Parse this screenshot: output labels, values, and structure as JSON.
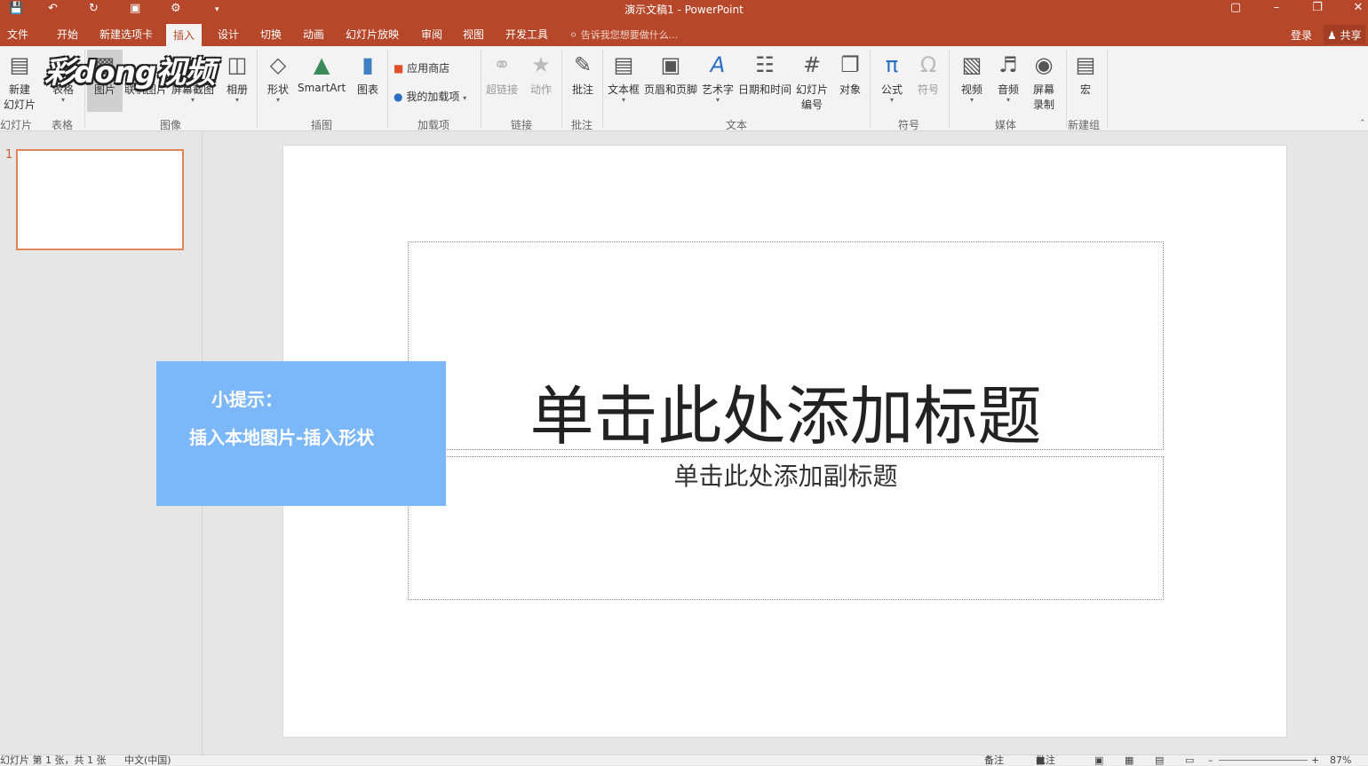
{
  "titlebar": {
    "title": "演示文稿1 - PowerPoint",
    "qa_save_icon": "save-icon",
    "qa_undo_icon": "undo-icon",
    "qa_redo_icon": "redo-icon",
    "qa_present_icon": "present-icon",
    "qa_touch_icon": "touch-icon",
    "qa_more_icon": "customize-icon",
    "win_restore_ribbon": "ribbon-display-icon",
    "win_min": "minimize-icon",
    "win_max": "restore-icon",
    "win_close": "close-icon"
  },
  "tabs": [
    "文件",
    "开始",
    "新建选项卡",
    "插入",
    "设计",
    "切换",
    "动画",
    "幻灯片放映",
    "审阅",
    "视图",
    "开发工具"
  ],
  "active_tab": "插入",
  "tellme": "告诉我您想要做什么...",
  "login": "登录",
  "share": "共享",
  "ribbon": {
    "new_slide": "新建",
    "new_slide_2": "幻灯片",
    "table": "表格",
    "pictures": "图片",
    "online_pictures": "联机图片",
    "screenshot": "屏幕截图",
    "album": "相册",
    "shapes": "形状",
    "smartart": "SmartArt",
    "chart": "图表",
    "store": "应用商店",
    "my_addins": "我的加载项",
    "hyperlink": "超链接",
    "action": "动作",
    "comment": "批注",
    "textbox": "文本框",
    "header_footer": "页眉和页脚",
    "wordart": "艺术字",
    "datetime": "日期和时间",
    "slide_number": "幻灯片",
    "slide_number_2": "编号",
    "object": "对象",
    "equation": "公式",
    "symbol": "符号",
    "video": "视频",
    "audio": "音频",
    "screen_record": "屏幕",
    "screen_record_2": "录制",
    "macro": "宏"
  },
  "groups": [
    "幻灯片",
    "表格",
    "图像",
    "插图",
    "加载项",
    "链接",
    "批注",
    "文本",
    "符号",
    "媒体",
    "新建组"
  ],
  "watermark": "彩dong视频",
  "slides_pane": {
    "number": "1"
  },
  "slide": {
    "title_placeholder": "单击此处添加标题",
    "subtitle_placeholder": "单击此处添加副标题"
  },
  "tip": {
    "line1": "小提示：",
    "line2": "插入本地图片-插入形状",
    "color": "#7cb7fa"
  },
  "statusbar": {
    "slide_info": "幻灯片 第 1 张，共 1 张",
    "language": "中文(中国)",
    "notes": "备注",
    "comments": "批注",
    "zoom": "87%"
  },
  "colors": {
    "accent": "#b7472a",
    "thumb_border": "#e0845c"
  }
}
